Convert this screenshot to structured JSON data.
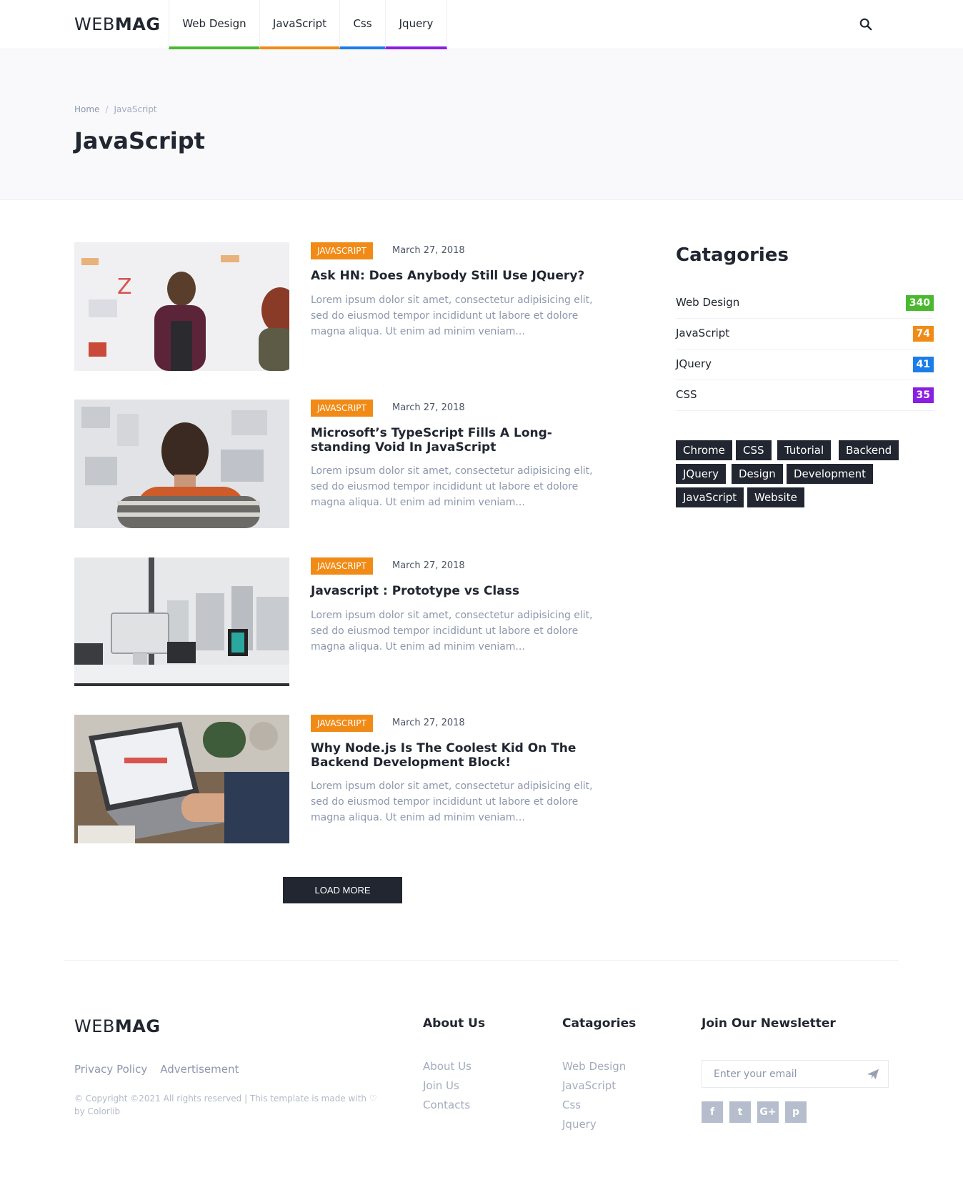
{
  "header": {
    "logo_light": "WEB",
    "logo_bold": "MAG",
    "nav": [
      {
        "label": "Web Design",
        "color": "#4bb92f"
      },
      {
        "label": "JavaScript",
        "color": "#f18b17"
      },
      {
        "label": "Css",
        "color": "#1b7ee8"
      },
      {
        "label": "Jquery",
        "color": "#8b1ee3"
      }
    ],
    "search_icon": "search-icon"
  },
  "page_header": {
    "breadcrumb_home": "Home",
    "breadcrumb_sep": "/",
    "breadcrumb_current": "JavaScript",
    "title": "JavaScript"
  },
  "posts": [
    {
      "tag": "JAVASCRIPT",
      "date": "March 27, 2018",
      "title": "Ask HN: Does Anybody Still Use JQuery?",
      "excerpt": "Lorem ipsum dolor sit amet, consectetur adipisicing elit, sed do eiusmod tempor incididunt ut labore et dolore magna aliqua. Ut enim ad minim veniam..."
    },
    {
      "tag": "JAVASCRIPT",
      "date": "March 27, 2018",
      "title": "Microsoft’s TypeScript Fills A Long-standing Void In JavaScript",
      "excerpt": "Lorem ipsum dolor sit amet, consectetur adipisicing elit, sed do eiusmod tempor incididunt ut labore et dolore magna aliqua. Ut enim ad minim veniam..."
    },
    {
      "tag": "JAVASCRIPT",
      "date": "March 27, 2018",
      "title": "Javascript : Prototype vs Class",
      "excerpt": "Lorem ipsum dolor sit amet, consectetur adipisicing elit, sed do eiusmod tempor incididunt ut labore et dolore magna aliqua. Ut enim ad minim veniam..."
    },
    {
      "tag": "JAVASCRIPT",
      "date": "March 27, 2018",
      "title": "Why Node.js Is The Coolest Kid On The Backend Development Block!",
      "excerpt": "Lorem ipsum dolor sit amet, consectetur adipisicing elit, sed do eiusmod tempor incididunt ut labore et dolore magna aliqua. Ut enim ad minim veniam..."
    }
  ],
  "load_more": "LOAD MORE",
  "sidebar": {
    "title": "Catagories",
    "categories": [
      {
        "name": "Web Design",
        "count": "340",
        "color": "#4bb92f"
      },
      {
        "name": "JavaScript",
        "count": "74",
        "color": "#f18b17"
      },
      {
        "name": "JQuery",
        "count": "41",
        "color": "#1b7ee8"
      },
      {
        "name": "CSS",
        "count": "35",
        "color": "#8b1ee3"
      }
    ],
    "tags": [
      "Chrome",
      "CSS",
      "Tutorial",
      "Backend",
      "JQuery",
      "Design",
      "Development",
      "JavaScript",
      "Website"
    ]
  },
  "footer": {
    "logo_light": "WEB",
    "logo_bold": "MAG",
    "links": [
      "Privacy Policy",
      "Advertisement"
    ],
    "copyright": "© Copyright ©2021 All rights reserved | This template is made with ♡ by Colorlib",
    "about": {
      "title": "About Us",
      "links": [
        "About Us",
        "Join Us",
        "Contacts"
      ]
    },
    "categories": {
      "title": "Catagories",
      "links": [
        "Web Design",
        "JavaScript",
        "Css",
        "Jquery"
      ]
    },
    "newsletter": {
      "title": "Join Our Newsletter",
      "placeholder": "Enter your email",
      "send_icon": "paper-plane-icon"
    },
    "social": [
      {
        "icon": "facebook-icon",
        "glyph": "f"
      },
      {
        "icon": "twitter-icon",
        "glyph": "t"
      },
      {
        "icon": "google-plus-icon",
        "glyph": "G+"
      },
      {
        "icon": "pinterest-icon",
        "glyph": "p"
      }
    ]
  }
}
